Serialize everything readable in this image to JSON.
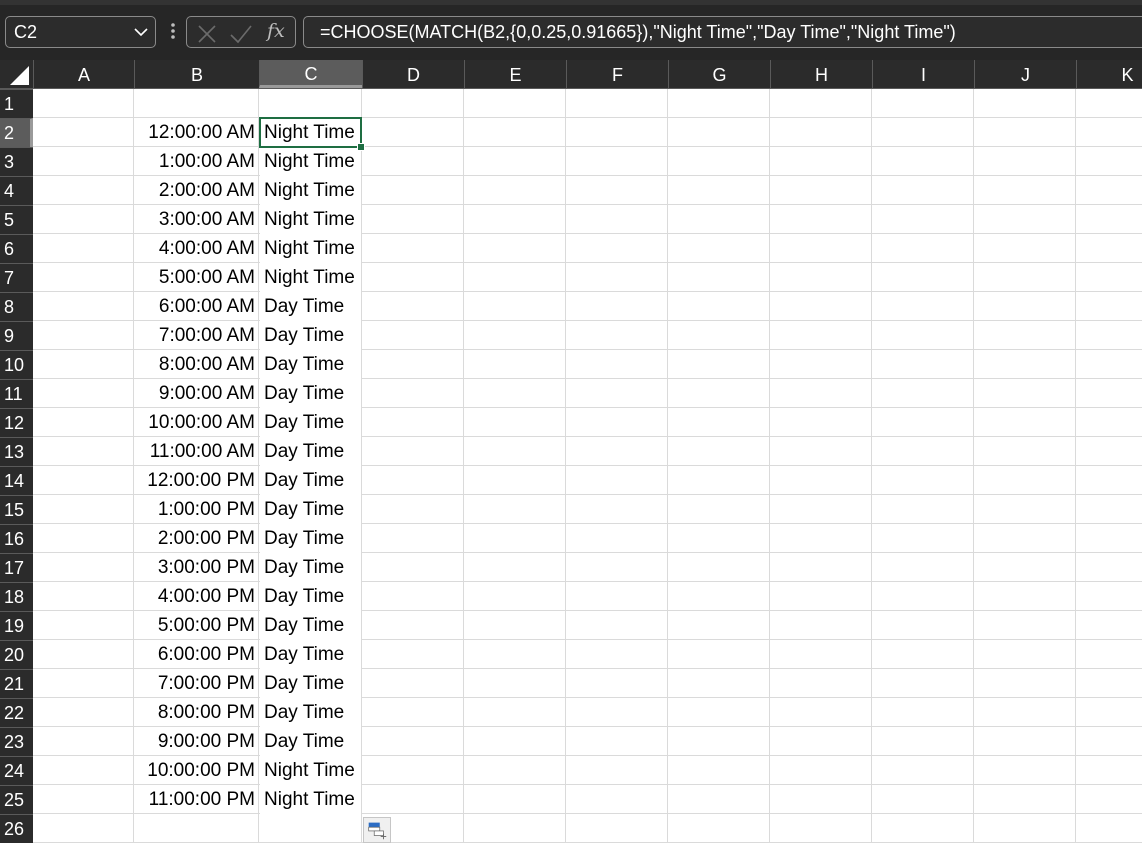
{
  "name_box": {
    "value": "C2",
    "icon": "chevron-down-icon"
  },
  "formula_bar": {
    "cancel_icon": "close-icon",
    "enter_icon": "check-icon",
    "fx_label": "fx",
    "formula": "=CHOOSE(MATCH(B2,{0,0.25,0.91665}),\"Night Time\",\"Day Time\",\"Night Time\")"
  },
  "columns": [
    "A",
    "B",
    "C",
    "D",
    "E",
    "F",
    "G",
    "H",
    "I",
    "J",
    "K"
  ],
  "active_column": "C",
  "active_row": 2,
  "rows": [
    {
      "row": "1",
      "time": "",
      "label": ""
    },
    {
      "row": "2",
      "time": "12:00:00 AM",
      "label": "Night Time"
    },
    {
      "row": "3",
      "time": "1:00:00 AM",
      "label": "Night Time"
    },
    {
      "row": "4",
      "time": "2:00:00 AM",
      "label": "Night Time"
    },
    {
      "row": "5",
      "time": "3:00:00 AM",
      "label": "Night Time"
    },
    {
      "row": "6",
      "time": "4:00:00 AM",
      "label": "Night Time"
    },
    {
      "row": "7",
      "time": "5:00:00 AM",
      "label": "Night Time"
    },
    {
      "row": "8",
      "time": "6:00:00 AM",
      "label": "Day Time"
    },
    {
      "row": "9",
      "time": "7:00:00 AM",
      "label": "Day Time"
    },
    {
      "row": "10",
      "time": "8:00:00 AM",
      "label": "Day Time"
    },
    {
      "row": "11",
      "time": "9:00:00 AM",
      "label": "Day Time"
    },
    {
      "row": "12",
      "time": "10:00:00 AM",
      "label": "Day Time"
    },
    {
      "row": "13",
      "time": "11:00:00 AM",
      "label": "Day Time"
    },
    {
      "row": "14",
      "time": "12:00:00 PM",
      "label": "Day Time"
    },
    {
      "row": "15",
      "time": "1:00:00 PM",
      "label": "Day Time"
    },
    {
      "row": "16",
      "time": "2:00:00 PM",
      "label": "Day Time"
    },
    {
      "row": "17",
      "time": "3:00:00 PM",
      "label": "Day Time"
    },
    {
      "row": "18",
      "time": "4:00:00 PM",
      "label": "Day Time"
    },
    {
      "row": "19",
      "time": "5:00:00 PM",
      "label": "Day Time"
    },
    {
      "row": "20",
      "time": "6:00:00 PM",
      "label": "Day Time"
    },
    {
      "row": "21",
      "time": "7:00:00 PM",
      "label": "Day Time"
    },
    {
      "row": "22",
      "time": "8:00:00 PM",
      "label": "Day Time"
    },
    {
      "row": "23",
      "time": "9:00:00 PM",
      "label": "Day Time"
    },
    {
      "row": "24",
      "time": "10:00:00 PM",
      "label": "Night Time"
    },
    {
      "row": "25",
      "time": "11:00:00 PM",
      "label": "Night Time"
    },
    {
      "row": "26",
      "time": "",
      "label": ""
    }
  ],
  "quick_analysis_icon": "quick-analysis-icon",
  "colors": {
    "header_bg": "#2b2b2b",
    "selection": "#1e6e42",
    "gridline": "#dadada"
  }
}
